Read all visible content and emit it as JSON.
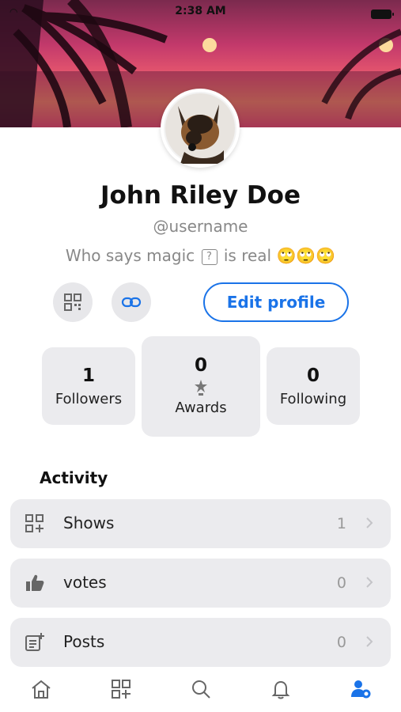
{
  "status_bar": {
    "time": "2:38 AM"
  },
  "profile": {
    "name": "John Riley Doe",
    "handle": "@username",
    "bio": "Who says magic",
    "bio_suffix": "is real",
    "bio_emoji": "🙄🙄🙄"
  },
  "actions": {
    "edit_label": "Edit profile"
  },
  "stats": [
    {
      "value": "1",
      "label": "Followers"
    },
    {
      "value": "0",
      "label": "Awards"
    },
    {
      "value": "0",
      "label": "Following"
    }
  ],
  "activity": {
    "title": "Activity",
    "rows": [
      {
        "label": "Shows",
        "count": "1",
        "icon": "grid-plus-icon"
      },
      {
        "label": "votes",
        "count": "0",
        "icon": "thumbs-up-icon"
      },
      {
        "label": "Posts",
        "count": "0",
        "icon": "post-add-icon"
      }
    ]
  },
  "tabbar": {
    "items": [
      "home-icon",
      "grid-plus-icon",
      "search-icon",
      "bell-icon",
      "profile-settings-icon"
    ],
    "active": "profile-settings-icon",
    "accent_color": "#1a73e8"
  },
  "colors": {
    "accent": "#1a73e8",
    "card_bg": "#ebebee"
  }
}
